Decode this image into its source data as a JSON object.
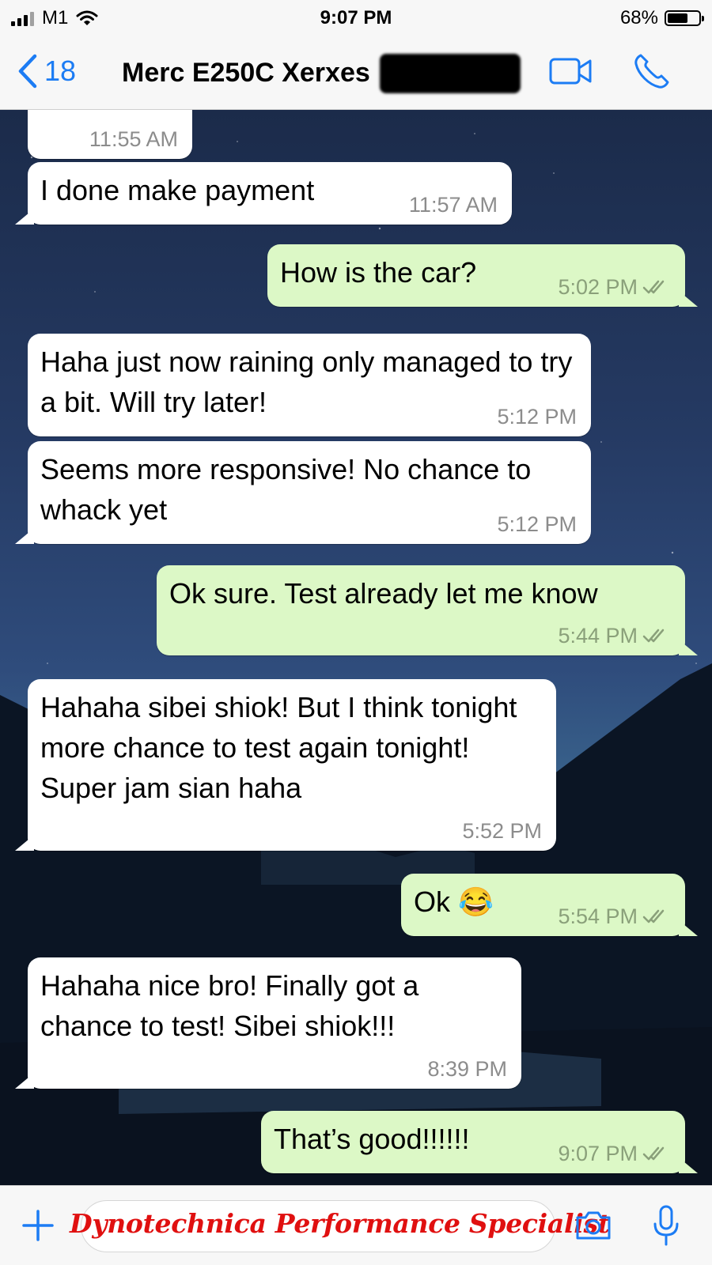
{
  "status_bar": {
    "carrier": "M1",
    "time": "9:07 PM",
    "battery_percent": "68%",
    "battery_level": 0.68
  },
  "nav": {
    "back_count": "18",
    "contact_name": "Merc E250C Xerxes",
    "accent_color": "#1c7cf4"
  },
  "messages": [
    {
      "dir": "in",
      "text": "",
      "time": "11:55 AM"
    },
    {
      "dir": "in",
      "text": "I done make payment",
      "time": "11:57 AM"
    },
    {
      "dir": "out",
      "text": "How is the car?",
      "time": "5:02 PM"
    },
    {
      "dir": "in",
      "text": "Haha just now raining only managed to try a bit. Will try later!",
      "time": "5:12 PM"
    },
    {
      "dir": "in",
      "text": "Seems more responsive! No chance to whack yet",
      "time": "5:12 PM"
    },
    {
      "dir": "out",
      "text": "Ok sure. Test already let me know",
      "time": "5:44 PM"
    },
    {
      "dir": "in",
      "text": "Hahaha sibei shiok! But I think tonight more chance to test again tonight! Super jam sian haha",
      "time": "5:52 PM"
    },
    {
      "dir": "out",
      "text": "Ok 😂",
      "time": "5:54 PM"
    },
    {
      "dir": "in",
      "text": "Hahaha nice bro! Finally got a chance to test! Sibei shiok!!!",
      "time": "8:39 PM"
    },
    {
      "dir": "out",
      "text": "That’s good!!!!!!",
      "time": "9:07 PM"
    }
  ],
  "input_bar": {
    "watermark": "Dynotechnica Performance Specialist",
    "watermark_color": "#e01010"
  },
  "icons": [
    "signal-icon",
    "wifi-icon",
    "battery-icon",
    "back-chevron-icon",
    "video-call-icon",
    "phone-icon",
    "double-check-icon",
    "plus-icon",
    "camera-icon",
    "microphone-icon"
  ]
}
